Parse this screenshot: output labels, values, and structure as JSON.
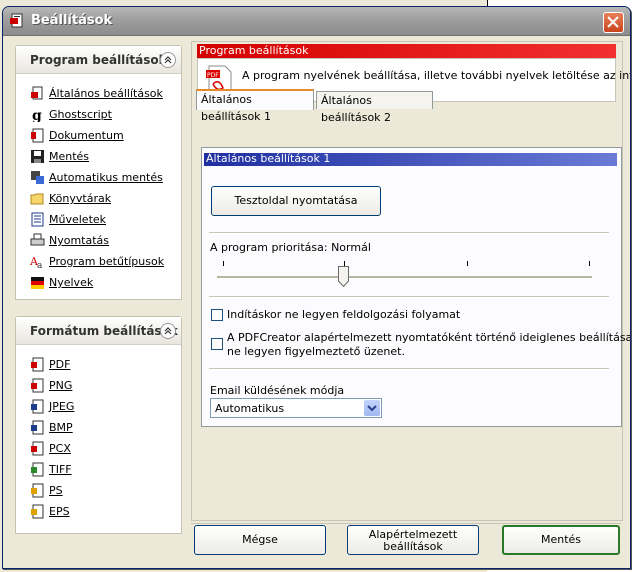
{
  "window": {
    "title": "Beállítások"
  },
  "program_panel": {
    "header": "Program beállítások",
    "items": [
      {
        "label": "Általános beállítások",
        "icon": "printer-document-icon"
      },
      {
        "label": "Ghostscript",
        "icon": "ghostscript-icon"
      },
      {
        "label": "Dokumentum",
        "icon": "document-icon"
      },
      {
        "label": "Mentés",
        "icon": "floppy-disk-icon"
      },
      {
        "label": "Automatikus mentés",
        "icon": "auto-save-icon"
      },
      {
        "label": "Könyvtárak",
        "icon": "folder-icon"
      },
      {
        "label": "Műveletek",
        "icon": "actions-icon"
      },
      {
        "label": "Nyomtatás",
        "icon": "printer-icon"
      },
      {
        "label": "Program betűtípusok",
        "icon": "font-icon"
      },
      {
        "label": "Nyelvek",
        "icon": "language-flag-icon"
      }
    ]
  },
  "format_panel": {
    "header": "Formátum beállítások",
    "items": [
      {
        "label": "PDF"
      },
      {
        "label": "PNG"
      },
      {
        "label": "JPEG"
      },
      {
        "label": "BMP"
      },
      {
        "label": "PCX"
      },
      {
        "label": "TIFF"
      },
      {
        "label": "PS"
      },
      {
        "label": "EPS"
      }
    ]
  },
  "main": {
    "section_bar": "Program beállítások",
    "info_text": "A program nyelvének beállítása, illetve további nyelvek letöltése az internetről.",
    "tabs": [
      {
        "label": "Általános beállítások 1",
        "active": true
      },
      {
        "label": "Általános beállítások 2",
        "active": false
      }
    ],
    "panel_title": "Általános beállítások 1",
    "test_page_button": "Tesztoldal nyomtatása",
    "priority_label": "A program prioritása: Normál",
    "priority_level": "2 of 4",
    "checkbox1": {
      "label": "Indításkor ne legyen feldolgozási folyamat",
      "checked": false
    },
    "checkbox2": {
      "line1": "A PDFCreator alapértelmezett nyomtatóként történő ideiglenes beállításakor",
      "line2": "ne legyen figyelmeztető üzenet.",
      "checked": false
    },
    "email_label": "Email küldésének módja",
    "email_value": "Automatikus"
  },
  "buttons": {
    "cancel": "Mégse",
    "defaults_line1": "Alapértelmezett",
    "defaults_line2": "beállítások",
    "save": "Mentés"
  },
  "colors": {
    "section_bar": "#e02020",
    "panel_title_bar": "#2a3aa8",
    "close_button": "#d4542c"
  }
}
